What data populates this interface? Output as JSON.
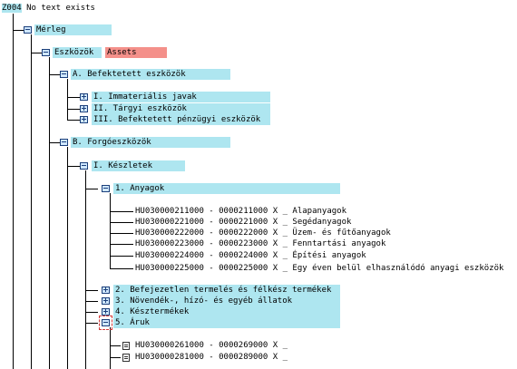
{
  "header": {
    "id": "Z004",
    "message": "No text exists"
  },
  "tree": {
    "root": {
      "label": "Mérleg"
    },
    "eszkozok": {
      "label": "Eszközök",
      "tag": "Assets"
    },
    "befektetett": {
      "label": "A. Befektetett eszközök",
      "children": [
        "I. Immateriális javak",
        "II. Tárgyi eszközök",
        "III. Befektetett pénzügyi eszközök"
      ]
    },
    "forgo": {
      "label": "B. Forgóeszközök"
    },
    "keszletek": {
      "label": "I. Készletek"
    },
    "anyagok": {
      "label": "1. Anyagok",
      "ranges": [
        {
          "range": "HU030000211000 - 0000211000",
          "flag": "X",
          "name": "_ Alapanyagok"
        },
        {
          "range": "HU030000221000 - 0000221000",
          "flag": "X",
          "name": "_ Segédanyagok"
        },
        {
          "range": "HU030000222000 - 0000222000",
          "flag": "X",
          "name": "_ Üzem- és fűtőanyagok"
        },
        {
          "range": "HU030000223000 - 0000223000",
          "flag": "X",
          "name": "_ Fenntartási anyagok"
        },
        {
          "range": "HU030000224000 - 0000224000",
          "flag": "X",
          "name": "_ Építési anyagok"
        },
        {
          "range": "HU030000225000 - 0000225000",
          "flag": "X",
          "name": "_ Egy éven belül elhasználódó anyagi eszközök"
        }
      ]
    },
    "other_items": [
      "2. Befejezetlen termelés és félkész termékek",
      "3. Növendék-, hízó- és egyéb állatok",
      "4. Késztermékek"
    ],
    "aruk": {
      "label": "5. Áruk",
      "ranges": [
        {
          "range": "HU030000261000 - 0000269000",
          "flag": "X",
          "name": "_"
        },
        {
          "range": "HU030000281000 - 0000289000",
          "flag": "X",
          "name": "_"
        }
      ]
    }
  }
}
